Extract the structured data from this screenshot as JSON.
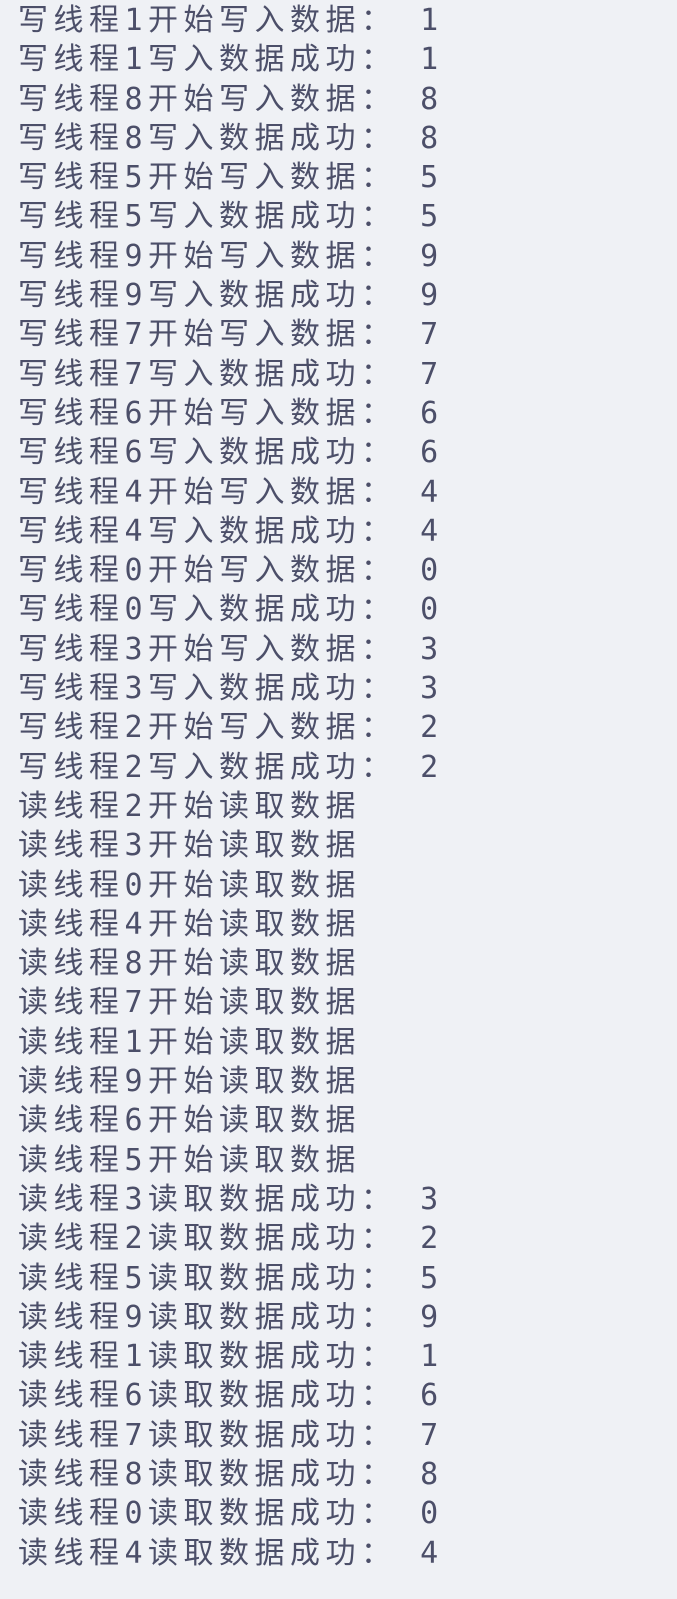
{
  "console": {
    "lines": [
      "写线程1开始写入数据： 1",
      "写线程1写入数据成功： 1",
      "写线程8开始写入数据： 8",
      "写线程8写入数据成功： 8",
      "写线程5开始写入数据： 5",
      "写线程5写入数据成功： 5",
      "写线程9开始写入数据： 9",
      "写线程9写入数据成功： 9",
      "写线程7开始写入数据： 7",
      "写线程7写入数据成功： 7",
      "写线程6开始写入数据： 6",
      "写线程6写入数据成功： 6",
      "写线程4开始写入数据： 4",
      "写线程4写入数据成功： 4",
      "写线程0开始写入数据： 0",
      "写线程0写入数据成功： 0",
      "写线程3开始写入数据： 3",
      "写线程3写入数据成功： 3",
      "写线程2开始写入数据： 2",
      "写线程2写入数据成功： 2",
      "读线程2开始读取数据",
      "读线程3开始读取数据",
      "读线程0开始读取数据",
      "读线程4开始读取数据",
      "读线程8开始读取数据",
      "读线程7开始读取数据",
      "读线程1开始读取数据",
      "读线程9开始读取数据",
      "读线程6开始读取数据",
      "读线程5开始读取数据",
      "读线程3读取数据成功： 3",
      "读线程2读取数据成功： 2",
      "读线程5读取数据成功： 5",
      "读线程9读取数据成功： 9",
      "读线程1读取数据成功： 1",
      "读线程6读取数据成功： 6",
      "读线程7读取数据成功： 7",
      "读线程8读取数据成功： 8",
      "读线程0读取数据成功： 0",
      "读线程4读取数据成功： 4"
    ]
  },
  "colors": {
    "background": "#eff1f5",
    "text": "#4c4f69"
  }
}
